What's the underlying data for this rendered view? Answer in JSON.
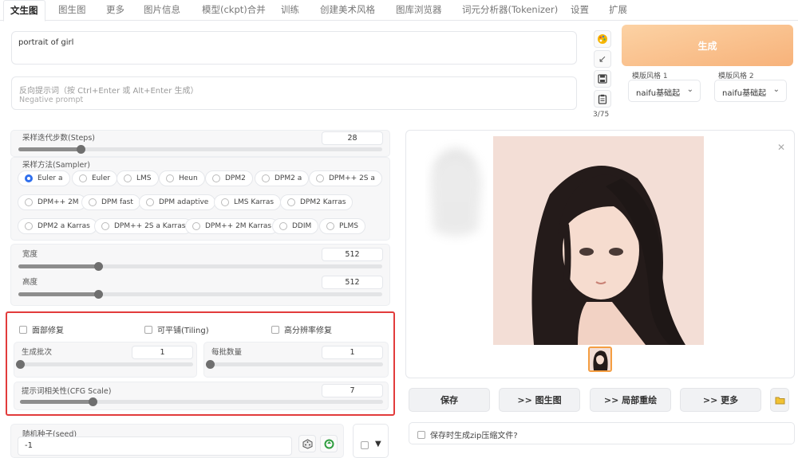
{
  "tabs": [
    {
      "label": "文生图",
      "active": true
    },
    {
      "label": "图生图"
    },
    {
      "label": "更多"
    },
    {
      "label": "图片信息"
    },
    {
      "label": "模型(ckpt)合并"
    },
    {
      "label": "训练"
    },
    {
      "label": "创建美术风格"
    },
    {
      "label": "图库浏览器"
    },
    {
      "label": "词元分析器(Tokenizer)"
    },
    {
      "label": "设置"
    },
    {
      "label": "扩展"
    }
  ],
  "prompt": {
    "value": "portrait of girl"
  },
  "negative_prompt": {
    "placeholder_line1": "反向提示词（按 Ctrl+Enter 或 Alt+Enter 生成）",
    "placeholder_line2": "Negative prompt"
  },
  "tool_icons": [
    "palette-icon",
    "arrow-diagonal-icon",
    "save-icon",
    "clipboard-icon"
  ],
  "token_counter": "3/75",
  "generate_label": "生成",
  "styles": [
    {
      "label": "模版风格 1",
      "value": "naifu基础起"
    },
    {
      "label": "模版风格 2",
      "value": "naifu基础起"
    }
  ],
  "steps": {
    "label": "采样迭代步数(Steps)",
    "value": "28",
    "fraction": 0.17
  },
  "sampler": {
    "label": "采样方法(Sampler)",
    "options": [
      "Euler a",
      "Euler",
      "LMS",
      "Heun",
      "DPM2",
      "DPM2 a",
      "DPM++ 2S a",
      "DPM++ 2M",
      "DPM fast",
      "DPM adaptive",
      "LMS Karras",
      "DPM2 Karras",
      "DPM2 a Karras",
      "DPM++ 2S a Karras",
      "DPM++ 2M Karras",
      "DDIM",
      "PLMS"
    ],
    "selected": "Euler a"
  },
  "width": {
    "label": "宽度",
    "value": "512",
    "fraction": 0.22
  },
  "height": {
    "label": "高度",
    "value": "512",
    "fraction": 0.22
  },
  "checks": {
    "restore_faces": "面部修复",
    "tiling": "可平铺(Tiling)",
    "hires_fix": "高分辨率修复"
  },
  "batch_count": {
    "label": "生成批次",
    "value": "1",
    "fraction": 0
  },
  "batch_size": {
    "label": "每批数量",
    "value": "1",
    "fraction": 0
  },
  "cfg_scale": {
    "label": "提示词相关性(CFG Scale)",
    "value": "7",
    "fraction": 0.2
  },
  "seed": {
    "label": "随机种子(seed)",
    "value": "-1"
  },
  "actions": {
    "save": "保存",
    "to_img2img": ">> 图生图",
    "to_inpaint": ">> 局部重绘",
    "more": ">> 更多"
  },
  "zip_option": "保存时生成zip压缩文件?",
  "colors": {
    "generate": "#f7b27a",
    "highlight_frame": "#e23b3b",
    "radio_selected": "#2f6fed"
  }
}
